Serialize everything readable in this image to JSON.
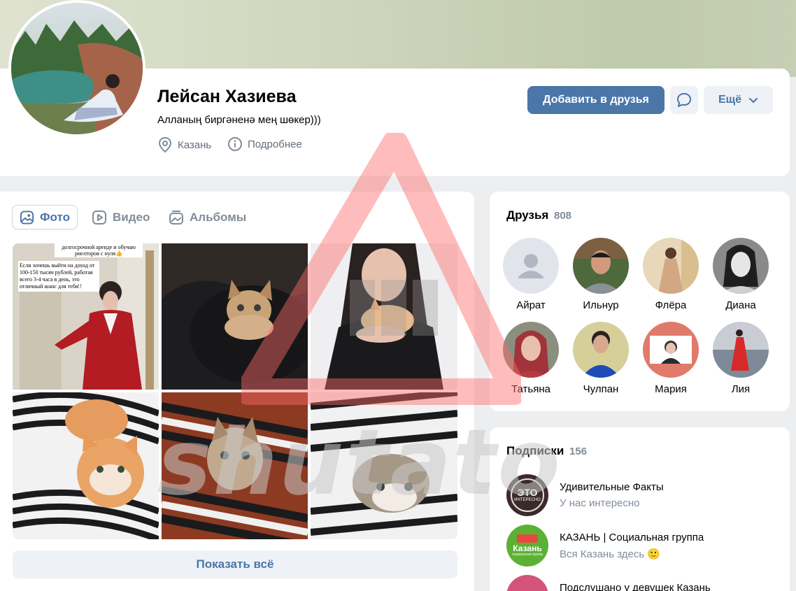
{
  "profile": {
    "name": "Лейсан Хазиева",
    "status": "Алланың биргәненә мең шөкер)))",
    "city": "Казань",
    "details_label": "Подробнее",
    "add_friend_label": "Добавить в друзья",
    "more_label": "Ещё"
  },
  "photos": {
    "tabs": [
      {
        "label": "Фото"
      },
      {
        "label": "Видео"
      },
      {
        "label": "Альбомы"
      }
    ],
    "show_all_label": "Показать всё",
    "photo1_text": {
      "top": "долгосрочной аренде и обучаю риелторов с нуля👍",
      "main": "Если хочешь выйти на доход от 100-150 тысяч рублей, работая всего 3-4 часа в день, это отличный шанс для тебя!!"
    }
  },
  "friends": {
    "title": "Друзья",
    "count": "808",
    "items": [
      {
        "name": "Айрат"
      },
      {
        "name": "Ильнур"
      },
      {
        "name": "Флёра"
      },
      {
        "name": "Диана"
      },
      {
        "name": "Татьяна"
      },
      {
        "name": "Чулпан"
      },
      {
        "name": "Мария"
      },
      {
        "name": "Лия"
      }
    ]
  },
  "subscriptions": {
    "title": "Подписки",
    "count": "156",
    "items": [
      {
        "title": "Удивительные Факты",
        "desc": "У нас интересно",
        "logo_text": "ЭТО",
        "logo_sub": "ИНТЕРЕСНО"
      },
      {
        "title": "КАЗАНЬ | Социальная группа",
        "desc": "Вся Казань здесь 🙂",
        "logo_text": "Казань",
        "logo_sub": "социальная группа"
      },
      {
        "title": "Подслушано у девушек Казань",
        "desc": ""
      }
    ]
  },
  "watermark": {
    "text": "shutato"
  },
  "colors": {
    "accent": "#4a76a8",
    "secondary_text": "#818c99",
    "background": "#edeef0"
  }
}
